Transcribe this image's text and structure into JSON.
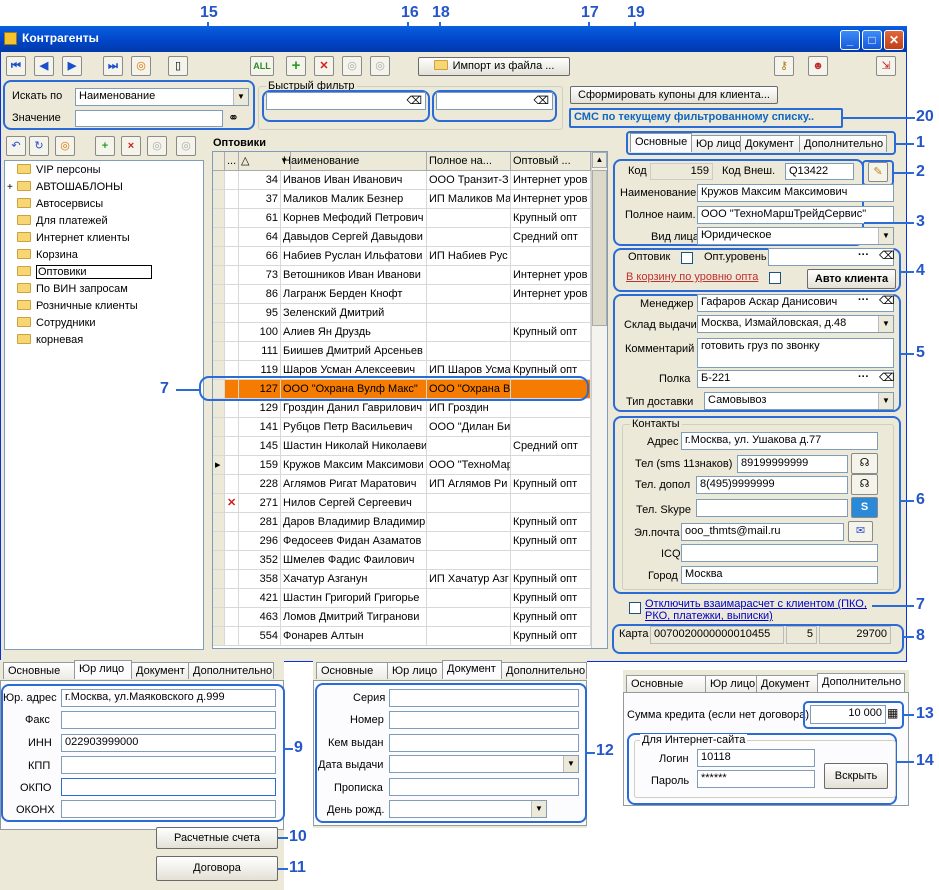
{
  "window": {
    "title": "Контрагенты"
  },
  "callouts": [
    "1",
    "2",
    "3",
    "4",
    "5",
    "6",
    "7",
    "7",
    "8",
    "9",
    "10",
    "11",
    "12",
    "13",
    "14",
    "15",
    "16",
    "17",
    "18",
    "19",
    "20"
  ],
  "toolbar": {
    "all_label": "ALL",
    "import_label": "Импорт из файла ...",
    "coupons_label": "Сформировать купоны для клиента...",
    "sms_label": "СМС по текущему фильтрованному списку.."
  },
  "search": {
    "search_by_label": "Искать по",
    "search_by_value": "Наименование",
    "value_label": "Значение",
    "value": "",
    "quick_filter_label": "Быстрый фильтр"
  },
  "tree": {
    "items": [
      {
        "label": "VIP персоны",
        "expand": ""
      },
      {
        "label": "АВТОШАБЛОНЫ",
        "expand": "+"
      },
      {
        "label": "Автосервисы",
        "expand": ""
      },
      {
        "label": "Для платежей",
        "expand": ""
      },
      {
        "label": "Интернет клиенты",
        "expand": ""
      },
      {
        "label": "Корзина",
        "expand": ""
      },
      {
        "label": "Оптовики",
        "expand": ""
      },
      {
        "label": "По ВИН запросам",
        "expand": ""
      },
      {
        "label": "Розничные клиенты",
        "expand": ""
      },
      {
        "label": "Сотрудники",
        "expand": ""
      },
      {
        "label": "корневая",
        "expand": ""
      }
    ]
  },
  "grid": {
    "title": "Оптовики",
    "headers": [
      "...",
      "Наименование",
      "Полное на...",
      "Оптовый ..."
    ],
    "rows": [
      {
        "id": "34",
        "name": "Иванов Иван Иванович",
        "full": "ООО Транзит-З",
        "level": "Интернет уров"
      },
      {
        "id": "37",
        "name": "Маликов Малик Безнер",
        "full": "ИП Маликов Ма",
        "level": "Интернет уров"
      },
      {
        "id": "61",
        "name": "Корнев Мефодий Петрович",
        "full": "",
        "level": "Крупный опт"
      },
      {
        "id": "64",
        "name": "Давыдов Сергей Давыдови",
        "full": "",
        "level": "Средний опт"
      },
      {
        "id": "66",
        "name": "Набиев Руслан Ильфатови",
        "full": "ИП Набиев Рус",
        "level": ""
      },
      {
        "id": "73",
        "name": "Ветошников Иван Иванови",
        "full": "",
        "level": "Интернет уров"
      },
      {
        "id": "86",
        "name": "Лагранж Берден Кнофт",
        "full": "",
        "level": "Интернет уров"
      },
      {
        "id": "95",
        "name": "Зеленский Дмитрий",
        "full": "",
        "level": ""
      },
      {
        "id": "100",
        "name": "Алиев Ян Друздь",
        "full": "",
        "level": "Крупный опт"
      },
      {
        "id": "111",
        "name": "Биишев Дмитрий Арсеньев",
        "full": "",
        "level": ""
      },
      {
        "id": "119",
        "name": "Шаров Усман Алексеевич",
        "full": "ИП Шаров Усма",
        "level": "Крупный опт"
      },
      {
        "id": "127",
        "name": "ООО \"Охрана Вулф Макс\"",
        "full": "ООО \"Охрана В",
        "level": ""
      },
      {
        "id": "129",
        "name": "Гроздин Данил Гаврилович",
        "full": "ИП Гроздин",
        "level": ""
      },
      {
        "id": "141",
        "name": "Рубцов Петр Васильевич",
        "full": "ООО \"Дилан Би",
        "level": ""
      },
      {
        "id": "145",
        "name": "Шастин Николай Николаеви",
        "full": "",
        "level": "Средний опт"
      },
      {
        "id": "159",
        "name": "Кружов Максим Максимови",
        "full": "ООО \"ТехноМар",
        "level": ""
      },
      {
        "id": "228",
        "name": "Аглямов Ригат Маратович",
        "full": "ИП Аглямов Ри",
        "level": "Крупный опт"
      },
      {
        "id": "271",
        "name": "Нилов Сергей Сергеевич",
        "full": "",
        "level": ""
      },
      {
        "id": "281",
        "name": "Даров Владимир Владимир",
        "full": "",
        "level": "Крупный опт"
      },
      {
        "id": "296",
        "name": "Федосеев Фидан Азаматов",
        "full": "",
        "level": "Крупный опт"
      },
      {
        "id": "352",
        "name": "Шмелев Фадис Фаилович",
        "full": "",
        "level": ""
      },
      {
        "id": "358",
        "name": "Хачатур Азганун",
        "full": "ИП Хачатур Азг",
        "level": "Крупный опт"
      },
      {
        "id": "421",
        "name": "Шастин Григорий Григорье",
        "full": "",
        "level": "Крупный опт"
      },
      {
        "id": "463",
        "name": "Ломов Дмитрий Тигранови",
        "full": "",
        "level": "Крупный опт"
      },
      {
        "id": "554",
        "name": "Фонарев Алтын",
        "full": "",
        "level": "Крупный опт"
      }
    ]
  },
  "tabs": [
    "Основные",
    "Юр лицо",
    "Документ",
    "Дополнительно"
  ],
  "main": {
    "code_label": "Код",
    "code": "159",
    "ext_code_label": "Код Внеш.",
    "ext_code": "Q13422",
    "name_label": "Наименование",
    "name": "Кружов Максим Максимович",
    "full_name_label": "Полное наим.",
    "full_name": "ООО \"ТехноМаршТрейдСервис\"",
    "entity_label": "Вид лица",
    "entity": "Юридическое",
    "wholesaler_label": "Оптовик",
    "wholesale_level_label": "Опт.уровень",
    "wholesale_level": "",
    "basket_label": "В корзину по уровню опта",
    "auto_client_label": "Авто клиента",
    "manager_label": "Менеджер",
    "manager": "Гафаров Аскар Данисович",
    "warehouse_label": "Склад выдачи",
    "warehouse": "Москва, Измайловская, д.48",
    "comment_label": "Комментарий",
    "comment": "готовить груз по звонку",
    "shelf_label": "Полка",
    "shelf": "Б-221",
    "delivery_label": "Тип доставки",
    "delivery": "Самовывоз",
    "contacts_label": "Контакты",
    "address_label": "Адрес",
    "address": "г.Москва, ул. Ушакова д.77",
    "phone_label": "Тел (sms 11знаков)",
    "phone": "89199999999",
    "phone2_label": "Тел. допол",
    "phone2": "8(495)9999999",
    "skype_label": "Тел. Skype",
    "skype": "",
    "email_label": "Эл.почта",
    "email": "ooo_thmts@mail.ru",
    "icq_label": "ICQ",
    "icq": "",
    "city_label": "Город",
    "city": "Москва",
    "offset_label": "Отключить взаимарасчет с клиентом (ПКО, РКО, платежки, выписки)",
    "card_label": "Карта",
    "card": "0070020000000010455",
    "card_count": "5",
    "card_sum": "29700"
  },
  "legal": {
    "address_label": "Юр. адрес",
    "address": "г.Москва, ул.Маяковского д.999",
    "fax_label": "Факс",
    "fax": "",
    "inn_label": "ИНН",
    "inn": "022903999000",
    "kpp_label": "КПП",
    "kpp": "",
    "okpo_label": "ОКПО",
    "okpo": "",
    "okonh_label": "ОКОНХ",
    "okonh": "",
    "accounts_label": "Расчетные счета",
    "contracts_label": "Договора"
  },
  "document": {
    "series_label": "Серия",
    "number_label": "Номер",
    "issued_by_label": "Кем выдан",
    "issue_date_label": "Дата выдачи",
    "registration_label": "Прописка",
    "birthday_label": "День рожд."
  },
  "extra": {
    "credit_label": "Сумма кредита (если нет договора)",
    "credit": "10 000",
    "site_label": "Для Интернет-сайта",
    "login_label": "Логин",
    "login": "10118",
    "password_label": "Пароль",
    "password": "******",
    "open_label": "Вскрыть"
  }
}
